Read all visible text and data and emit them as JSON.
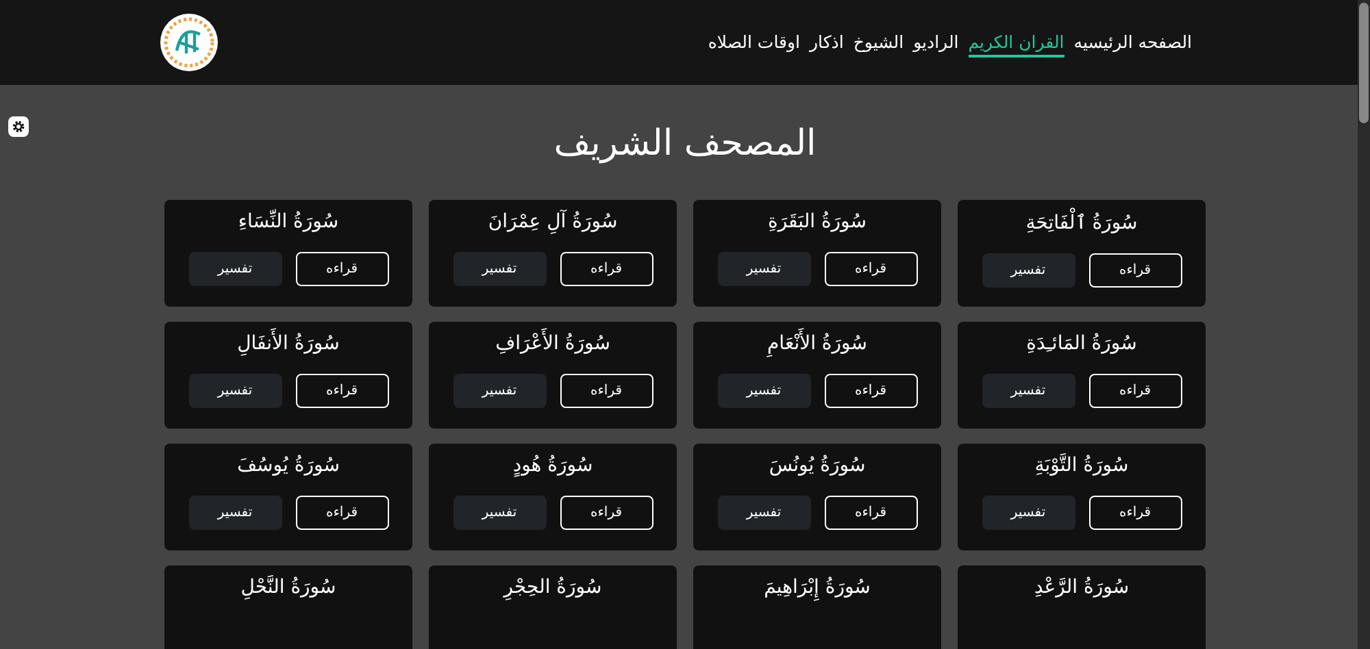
{
  "navbar": {
    "links": [
      {
        "label": "الصفحه الرئيسيه",
        "selected": false
      },
      {
        "label": "القران الكريم",
        "selected": true
      },
      {
        "label": "الراديو",
        "selected": false
      },
      {
        "label": "الشيوخ",
        "selected": false
      },
      {
        "label": "اذكار",
        "selected": false
      },
      {
        "label": "اوقات الصلاه",
        "selected": false
      }
    ]
  },
  "page_title": "المصحف الشريف",
  "surahs": [
    {
      "name": "سُورَةُ ٱلْفَاتِحَةِ",
      "actions": [
        "قراءه",
        "تفسير"
      ]
    },
    {
      "name": "سُورَةُ البَقَرَةِ",
      "actions": [
        "قراءه",
        "تفسير"
      ]
    },
    {
      "name": "سُورَةُ آلِ عِمْرَانَ",
      "actions": [
        "قراءه",
        "تفسير"
      ]
    },
    {
      "name": "سُورَةُ النِّسَاءِ",
      "actions": [
        "قراءه",
        "تفسير"
      ]
    },
    {
      "name": "سُورَةُ المَائـِدَةِ",
      "actions": [
        "قراءه",
        "تفسير"
      ]
    },
    {
      "name": "سُورَةُ الأَنْعَامِ",
      "actions": [
        "قراءه",
        "تفسير"
      ]
    },
    {
      "name": "سُورَةُ الأَعْرَافِ",
      "actions": [
        "قراءه",
        "تفسير"
      ]
    },
    {
      "name": "سُورَةُ الأَنفَالِ",
      "actions": [
        "قراءه",
        "تفسير"
      ]
    },
    {
      "name": "سُورَةُ التَّوْبَةِ",
      "actions": [
        "قراءه",
        "تفسير"
      ]
    },
    {
      "name": "سُورَةُ يُونُسَ",
      "actions": [
        "قراءه",
        "تفسير"
      ]
    },
    {
      "name": "سُورَةُ هُودٍ",
      "actions": [
        "قراءه",
        "تفسير"
      ]
    },
    {
      "name": "سُورَةُ يُوسُفَ",
      "actions": [
        "قراءه",
        "تفسير"
      ]
    },
    {
      "name": "سُورَةُ الرَّعْدِ"
    },
    {
      "name": "سُورَةُ إِبْرَاهِيمَ"
    },
    {
      "name": "سُورَةُ الحِجْرِ"
    },
    {
      "name": "سُورَةُ النَّحْلِ"
    }
  ]
}
